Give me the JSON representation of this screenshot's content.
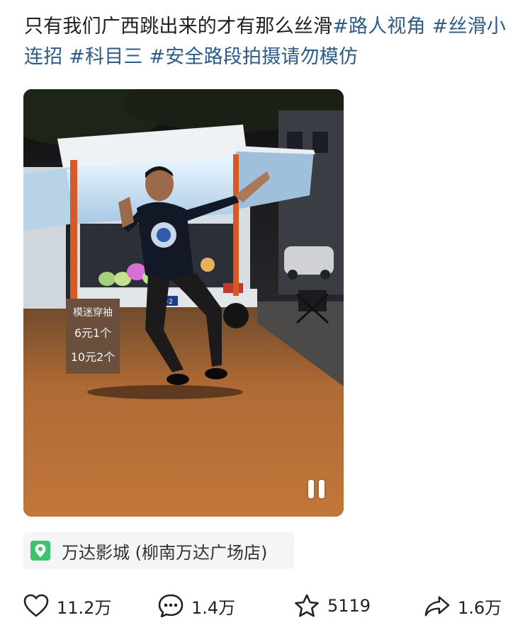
{
  "post": {
    "text": "只有我们广西跳出来的才有那么丝滑",
    "hashtags": [
      "#路人视角",
      " #丝滑小连招",
      " #科目三",
      " #安全路段拍摄请勿模仿"
    ]
  },
  "video": {
    "sign_line1": "模迷穿袖",
    "sign_line2": "6元1个",
    "sign_line3": "10元2个",
    "plate": "桂B·2"
  },
  "location": {
    "name": "万达影城 (柳南万达广场店)",
    "icon_color": "#3cc46b"
  },
  "actions": {
    "likes": "11.2万",
    "comments": "1.4万",
    "favorites": "5119",
    "shares": "1.6万"
  },
  "colors": {
    "hashtag": "#2c5b86",
    "text": "#1f1f1f"
  }
}
